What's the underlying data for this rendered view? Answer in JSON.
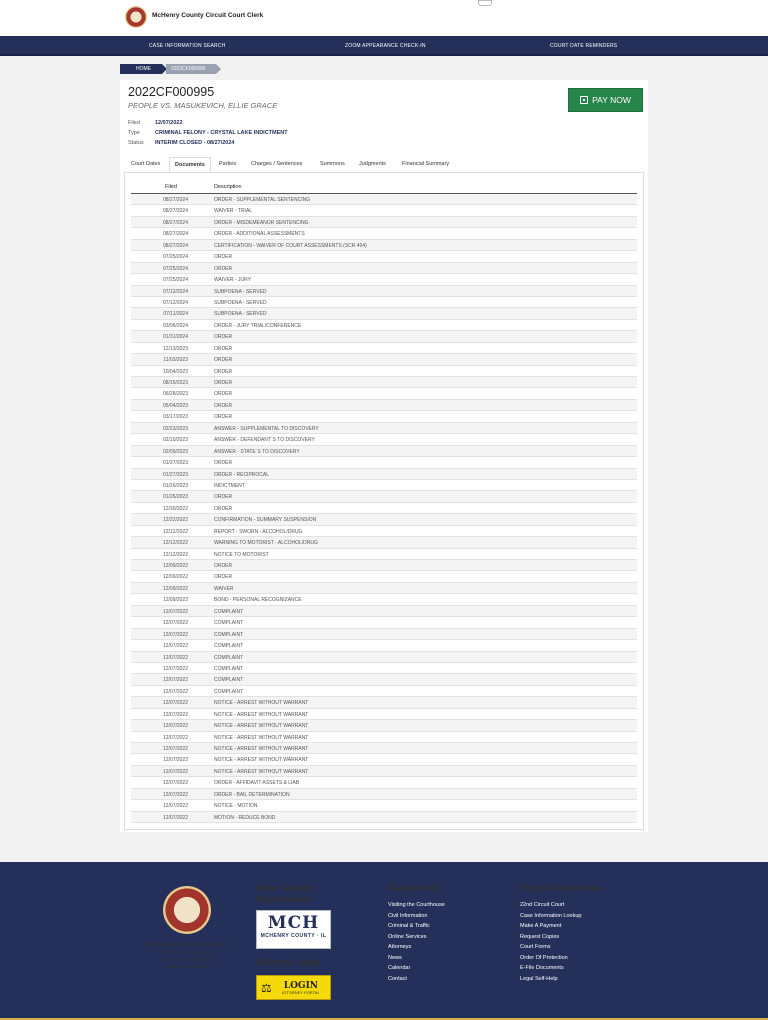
{
  "header": {
    "site_title": "McHenry County Circuit Court Clerk"
  },
  "nav": {
    "items": [
      "CASE INFORMATION SEARCH",
      "ZOOM APPEARANCE CHECK-IN",
      "COURT DATE REMINDERS"
    ]
  },
  "breadcrumb": {
    "home": "HOME",
    "current": "2022CF000995"
  },
  "case": {
    "number": "2022CF000995",
    "parties": "PEOPLE VS. MASUKEVICH, ELLIE GRACE",
    "filed_label": "Filed",
    "filed": "12/07/2022",
    "type_label": "Type",
    "type": "CRIMINAL FELONY - CRYSTAL LAKE INDICTMENT",
    "status_label": "Status",
    "status": "INTERIM CLOSED - 08/27/2024",
    "pay_label": "PAY NOW"
  },
  "tabs": [
    "Court Dates",
    "Documents",
    "Parties",
    "Charges / Sentences",
    "Summons",
    "Judgments",
    "Financial Summary"
  ],
  "active_tab": "Documents",
  "documents": {
    "headers": {
      "filed": "Filed",
      "description": "Description"
    },
    "rows": [
      [
        "08/27/2024",
        "ORDER - SUPPLEMENTAL SENTENCING"
      ],
      [
        "08/27/2024",
        "WAIVER - TRIAL"
      ],
      [
        "08/27/2024",
        "ORDER - MISDEMEANOR SENTENCING"
      ],
      [
        "08/27/2024",
        "ORDER - ADDITIONAL ASSESSMENTS"
      ],
      [
        "08/27/2024",
        "CERTIFICATION - WAIVER OF COURT ASSESSMENTS (SCR 404)"
      ],
      [
        "07/25/2024",
        "ORDER"
      ],
      [
        "07/25/2024",
        "ORDER"
      ],
      [
        "07/25/2024",
        "WAIVER - JURY"
      ],
      [
        "07/12/2024",
        "SUBPOENA - SERVED"
      ],
      [
        "07/12/2024",
        "SUBPOENA - SERVED"
      ],
      [
        "07/11/2024",
        "SUBPOENA - SERVED"
      ],
      [
        "03/06/2024",
        "ORDER - JURY TRIAL/CONFERENCE"
      ],
      [
        "01/31/2024",
        "ORDER"
      ],
      [
        "12/13/2023",
        "ORDER"
      ],
      [
        "11/03/2023",
        "ORDER"
      ],
      [
        "10/04/2023",
        "ORDER"
      ],
      [
        "08/15/2023",
        "ORDER"
      ],
      [
        "06/28/2023",
        "ORDER"
      ],
      [
        "05/04/2023",
        "ORDER"
      ],
      [
        "03/17/2023",
        "ORDER"
      ],
      [
        "02/23/2023",
        "ANSWER - SUPPLEMENTAL TO DISCOVERY"
      ],
      [
        "02/10/2023",
        "ANSWER - DEFENDANT`S TO DISCOVERY"
      ],
      [
        "02/09/2023",
        "ANSWER - STATE`S TO DISCOVERY"
      ],
      [
        "01/27/2023",
        "ORDER"
      ],
      [
        "01/27/2023",
        "ORDER - RECIPROCAL"
      ],
      [
        "01/26/2023",
        "INDICTMENT"
      ],
      [
        "01/26/2023",
        "ORDER"
      ],
      [
        "12/30/2022",
        "ORDER"
      ],
      [
        "12/22/2022",
        "CONFIRMATION - SUMMARY SUSPENSION"
      ],
      [
        "12/12/2022",
        "REPORT - SWORN - ALCOHOL/DRUG"
      ],
      [
        "12/12/2022",
        "WARNING TO MOTORIST - ALCOHOL/DRUG"
      ],
      [
        "12/12/2022",
        "NOTICE TO MOTORIST"
      ],
      [
        "12/09/2022",
        "ORDER"
      ],
      [
        "12/09/2022",
        "ORDER"
      ],
      [
        "12/09/2022",
        "WAIVER"
      ],
      [
        "12/09/2022",
        "BOND - PERSONAL RECOGNIZANCE"
      ],
      [
        "12/07/2022",
        "COMPLAINT"
      ],
      [
        "12/07/2022",
        "COMPLAINT"
      ],
      [
        "12/07/2022",
        "COMPLAINT"
      ],
      [
        "12/07/2022",
        "COMPLAINT"
      ],
      [
        "12/07/2022",
        "COMPLAINT"
      ],
      [
        "12/07/2022",
        "COMPLAINT"
      ],
      [
        "12/07/2022",
        "COMPLAINT"
      ],
      [
        "12/07/2022",
        "COMPLAINT"
      ],
      [
        "12/07/2022",
        "NOTICE - ARREST WITHOUT WARRANT"
      ],
      [
        "12/07/2022",
        "NOTICE - ARREST WITHOUT WARRANT"
      ],
      [
        "12/07/2022",
        "NOTICE - ARREST WITHOUT WARRANT"
      ],
      [
        "12/07/2022",
        "NOTICE - ARREST WITHOUT WARRANT"
      ],
      [
        "12/07/2022",
        "NOTICE - ARREST WITHOUT WARRANT"
      ],
      [
        "12/07/2022",
        "NOTICE - ARREST WITHOUT WARRANT"
      ],
      [
        "12/07/2022",
        "NOTICE - ARREST WITHOUT WARRANT"
      ],
      [
        "12/07/2022",
        "ORDER - AFFIDAVIT ASSETS & LIAB"
      ],
      [
        "12/07/2022",
        "ORDER - BAIL DETERMINATION"
      ],
      [
        "12/07/2022",
        "NOTICE - MOTION"
      ],
      [
        "12/07/2022",
        "MOTION - REDUCE BOND"
      ]
    ]
  },
  "footer": {
    "clerk_name": "McHenry County Circuit Clerk",
    "address_line1": "2200 N. Seminary Ave",
    "address_line2": "Woodstock, IL 60098",
    "address_line3": "Rooms 136 & 353",
    "other_departments_title": "Other County Departments",
    "mch_logo_text": "MCH",
    "mch_logo_subtext": "MCHENRY COUNTY · IL",
    "attorney_login_title": "Attorney Login",
    "login_logo_text": "LOGIN",
    "login_logo_subtext": "ATTORNEY PORTAL",
    "general_info_title": "General Info",
    "general_info_links": [
      "Visiting the Courthouse",
      "Civil Information",
      "Criminal & Traffic",
      "Online Services",
      "Attorneys",
      "News",
      "Calendar",
      "Contact"
    ],
    "popular_title": "Popular Resources",
    "popular_links": [
      "22nd Circuit Court",
      "Case Information Lookup",
      "Make A Payment",
      "Request Copies",
      "Court Forms",
      "Order Of Protection",
      "E-File Documents",
      "Legal Self-Help"
    ]
  }
}
